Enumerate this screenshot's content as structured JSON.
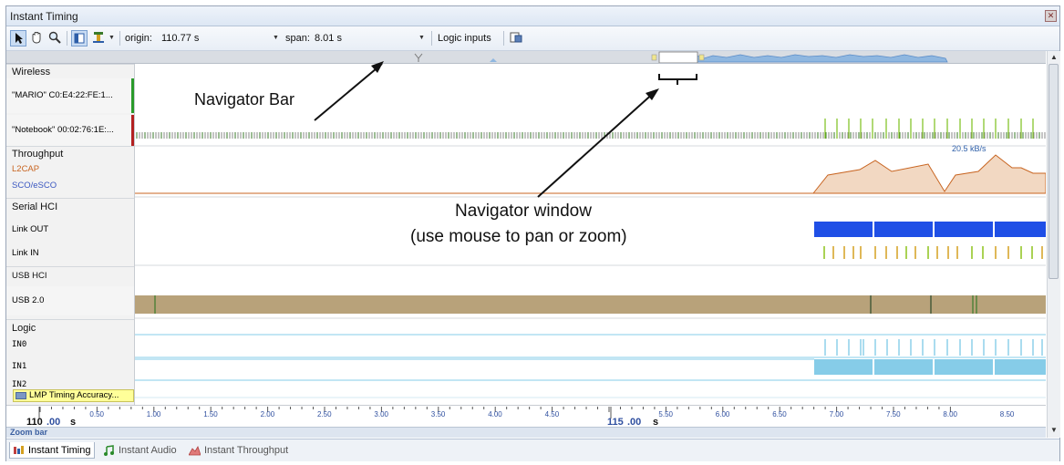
{
  "window": {
    "title": "Instant Timing"
  },
  "toolbar": {
    "origin_label": "origin:",
    "origin_value": "110.77 s",
    "span_label": "span:",
    "span_value": "8.01 s",
    "logic_inputs_label": "Logic inputs",
    "icons": [
      "pointer-icon",
      "hand-icon",
      "zoom-icon",
      "layout-icon",
      "marker-icon",
      "export-icon"
    ]
  },
  "channels": {
    "wireless": "Wireless",
    "mario": "\"MARIO\" C0:E4:22:FE:1...",
    "notebook": "\"Notebook\" 00:02:76:1E:...",
    "throughput": "Throughput",
    "l2cap": "L2CAP",
    "sco": "SCO/eSCO",
    "throughput_value": "20.5 kB/s",
    "serial_hci": "Serial HCI",
    "link_out": "Link OUT",
    "link_in": "Link IN",
    "usb_hci": "USB HCI",
    "usb20": "USB 2.0",
    "logic": "Logic",
    "in0": "IN0",
    "in1": "IN1",
    "in2": "IN2",
    "lmp_badge": "LMP Timing Accuracy..."
  },
  "annotations": {
    "navigator_bar": "Navigator Bar",
    "navigator_window": "Navigator window",
    "navigator_hint": "(use mouse to pan or zoom)"
  },
  "axis": {
    "ticks": [
      "0.50",
      "1.00",
      "1.50",
      "2.00",
      "2.50",
      "3.00",
      "3.50",
      "4.00",
      "4.50",
      "5.50",
      "6.00",
      "6.50",
      "7.00",
      "7.50",
      "8.00",
      "8.50"
    ],
    "major_left_prefix": "110",
    "major_left_suffix": ".00",
    "major_left_unit": "s",
    "major_mid_prefix": "115",
    "major_mid_suffix": ".00",
    "major_mid_unit": "s"
  },
  "zoombar": {
    "label": "Zoom bar"
  },
  "tabs": [
    {
      "label": "Instant Timing",
      "active": true
    },
    {
      "label": "Instant Audio",
      "active": false
    },
    {
      "label": "Instant Throughput",
      "active": false
    }
  ],
  "colors": {
    "mario_marker": "#2a9a2a",
    "notebook_marker": "#b22020",
    "l2cap": "#c86420",
    "sco": "#3a57c0",
    "link_out": "#1f4fe6",
    "link_in": "#8ec21a",
    "usb20_band": "#b8a27a",
    "logic_cyan": "#86cce8"
  }
}
